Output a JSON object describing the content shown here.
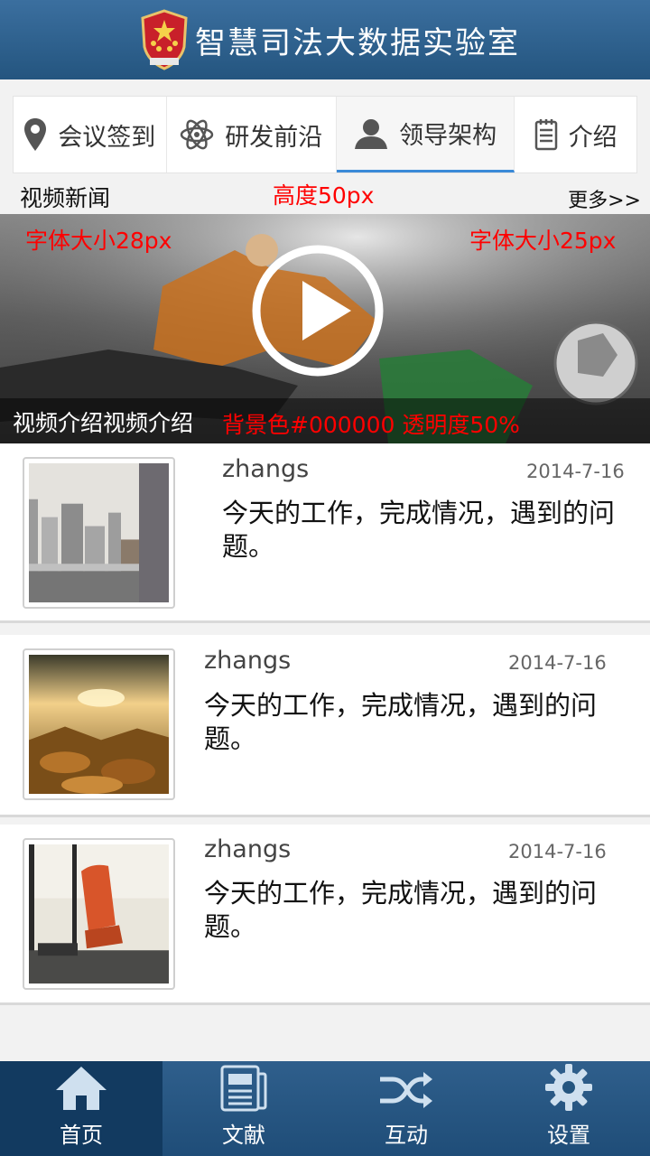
{
  "header": {
    "title": "智慧司法大数据实验室",
    "emblem_icon": "national-emblem-icon"
  },
  "tabs": [
    {
      "label": "会议签到",
      "icon": "location-pin-icon",
      "active": false
    },
    {
      "label": "研发前沿",
      "icon": "atom-icon",
      "active": false
    },
    {
      "label": "领导架构",
      "icon": "user-icon",
      "active": true
    },
    {
      "label": "介绍",
      "icon": "notepad-icon",
      "active": false
    }
  ],
  "section": {
    "title": "视频新闻",
    "more": "更多>>"
  },
  "annotations": {
    "height": "高度50px",
    "font28": "字体大小28px",
    "font25": "字体大小25px",
    "bg": "背景色#000000  透明度50%"
  },
  "video": {
    "caption": "视频介绍视频介绍",
    "play_icon": "play-icon"
  },
  "news": [
    {
      "author": "zhangs",
      "date": "2014-7-16",
      "text": "今天的工作，完成情况，遇到的问题。",
      "thumb": "city-skyline-image"
    },
    {
      "author": "zhangs",
      "date": "2014-7-16",
      "text": "今天的工作，完成情况，遇到的问题。",
      "thumb": "autumn-leaves-image"
    },
    {
      "author": "zhangs",
      "date": "2014-7-16",
      "text": "今天的工作，完成情况，遇到的问题。",
      "thumb": "bus-seat-image"
    }
  ],
  "bottom_nav": [
    {
      "label": "首页",
      "icon": "home-icon",
      "active": true
    },
    {
      "label": "文献",
      "icon": "newspaper-icon",
      "active": false
    },
    {
      "label": "互动",
      "icon": "shuffle-icon",
      "active": false
    },
    {
      "label": "设置",
      "icon": "gear-icon",
      "active": false
    }
  ],
  "colors": {
    "header": "#2a5d8a",
    "accent": "#3a8ad8",
    "annotation": "#ff0000"
  }
}
